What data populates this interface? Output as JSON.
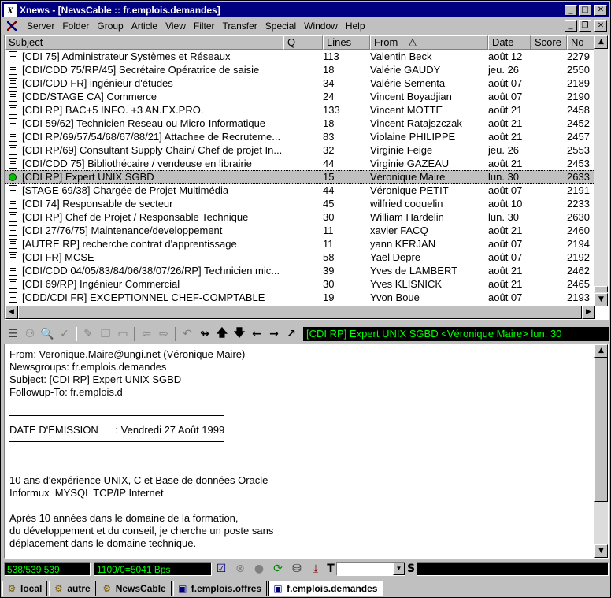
{
  "window": {
    "title": "Xnews - [NewsCable :: fr.emplois.demandes]",
    "app_icon_glyph": "X"
  },
  "menu": [
    "Server",
    "Folder",
    "Group",
    "Article",
    "View",
    "Filter",
    "Transfer",
    "Special",
    "Window",
    "Help"
  ],
  "columns": [
    "Subject",
    "Q",
    "Lines",
    "From",
    "Date",
    "Score",
    "No"
  ],
  "articles": [
    {
      "icon": "document-icon",
      "subject": "[CDI 75] Administrateur Systèmes et Réseaux",
      "lines": "113",
      "from": "Valentin Beck",
      "date": "août 12",
      "no": "2279"
    },
    {
      "icon": "document-icon",
      "subject": "[CDI/CDD 75/RP/45] Secrétaire  Opératrice de saisie",
      "lines": "18",
      "from": "Valérie GAUDY",
      "date": "jeu. 26",
      "no": "2550"
    },
    {
      "icon": "document-icon",
      "subject": "[CDI/CDD FR] ingénieur d'études",
      "lines": "34",
      "from": "Valérie Sementa",
      "date": "août 07",
      "no": "2189"
    },
    {
      "icon": "document-icon",
      "subject": "[CDD/STAGE CA] Commerce",
      "lines": "24",
      "from": "Vincent Boyadjian",
      "date": "août 07",
      "no": "2190"
    },
    {
      "icon": "document-icon",
      "subject": "[CDI RP] BAC+5 INFO. +3 AN.EX.PRO.",
      "lines": "133",
      "from": "Vincent MOTTE",
      "date": "août 21",
      "no": "2458"
    },
    {
      "icon": "document-icon",
      "subject": "[CDI 59/62] Technicien Reseau ou Micro-Informatique",
      "lines": "18",
      "from": "Vincent Ratajszczak",
      "date": "août 21",
      "no": "2452"
    },
    {
      "icon": "document-icon",
      "subject": "[CDI RP/69/57/54/68/67/88/21] Attachee de Recruteme...",
      "lines": "83",
      "from": "Violaine PHILIPPE",
      "date": "août 21",
      "no": "2457"
    },
    {
      "icon": "document-icon",
      "subject": "[CDI RP/69] Consultant Supply Chain/ Chef de projet In...",
      "lines": "32",
      "from": "Virginie Feige",
      "date": "jeu. 26",
      "no": "2553"
    },
    {
      "icon": "document-icon",
      "subject": "[CDI/CDD 75] Bibliothécaire / vendeuse en librairie",
      "lines": "44",
      "from": "Virginie GAZEAU",
      "date": "août 21",
      "no": "2453"
    },
    {
      "icon": "green-dot-icon",
      "subject": "[CDI RP] Expert UNIX SGBD",
      "lines": "15",
      "from": "Véronique Maire",
      "date": "lun. 30",
      "no": "2633",
      "selected": true
    },
    {
      "icon": "document-icon",
      "subject": "[STAGE 69/38] Chargée de Projet Multimédia",
      "lines": "44",
      "from": "Véronique PETIT",
      "date": "août 07",
      "no": "2191"
    },
    {
      "icon": "document-icon",
      "subject": "[CDI 74] Responsable de secteur",
      "lines": "45",
      "from": "wilfried coquelin",
      "date": "août 10",
      "no": "2233"
    },
    {
      "icon": "document-icon",
      "subject": "[CDI RP] Chef de Projet / Responsable Technique",
      "lines": "30",
      "from": "William Hardelin",
      "date": "lun. 30",
      "no": "2630"
    },
    {
      "icon": "document-icon",
      "subject": "[CDI 27/76/75] Maintenance/developpement",
      "lines": "11",
      "from": "xavier FACQ",
      "date": "août 21",
      "no": "2460"
    },
    {
      "icon": "document-icon",
      "subject": "[AUTRE RP] recherche contrat d'apprentissage",
      "lines": "11",
      "from": "yann KERJAN",
      "date": "août 07",
      "no": "2194"
    },
    {
      "icon": "document-icon",
      "subject": "[CDI FR] MCSE",
      "lines": "58",
      "from": "Yaël Depre",
      "date": "août 07",
      "no": "2192"
    },
    {
      "icon": "document-icon",
      "subject": "[CDI/CDD 04/05/83/84/06/38/07/26/RP] Technicien mic...",
      "lines": "39",
      "from": "Yves de LAMBERT",
      "date": "août 21",
      "no": "2462"
    },
    {
      "icon": "document-icon",
      "subject": "[CDI 69/RP] Ingénieur Commercial",
      "lines": "30",
      "from": "Yves KLISNICK",
      "date": "août 21",
      "no": "2465"
    },
    {
      "icon": "document-icon",
      "subject": "[CDD/CDI FR] EXCEPTIONNEL CHEF-COMPTABLE",
      "lines": "19",
      "from": "Yvon Boue",
      "date": "août 07",
      "no": "2193"
    }
  ],
  "toolbar_status": "[CDI RP] Expert UNIX SGBD <Véronique Maire> lun. 30",
  "message": {
    "headers": [
      "From: Veronique.Maire@ungi.net (Véronique Maire)",
      "Newsgroups: fr.emplois.demandes",
      "Subject: [CDI RP] Expert UNIX SGBD",
      "Followup-To: fr.emplois.d"
    ],
    "date_line": "DATE D'EMISSION      : Vendredi 27 Août 1999",
    "body": [
      "10 ans d'expérience UNIX, C et Base de données Oracle",
      "Informux  MYSQL TCP/IP Internet",
      "",
      "Après 10 années dans le domaine de la formation,",
      "du développement et du conseil, je cherche un poste sans",
      "déplacement dans le domaine technique."
    ]
  },
  "statusbar": {
    "count": "538/539 539",
    "speed": "1109/0=5041 Bps",
    "filter_letter": "T",
    "s_label": "S"
  },
  "tabs": [
    {
      "label": "local",
      "icon": "server-icon"
    },
    {
      "label": "autre",
      "icon": "server-icon"
    },
    {
      "label": "NewsCable",
      "icon": "server-icon"
    },
    {
      "label": "f.emplois.offres",
      "icon": "newsgroup-icon"
    },
    {
      "label": "f.emplois.demandes",
      "icon": "newsgroup-icon",
      "active": true
    }
  ],
  "colors": {
    "titlebar": "#000080",
    "status_text": "#00ff00",
    "selected_dot": "#00c000"
  }
}
